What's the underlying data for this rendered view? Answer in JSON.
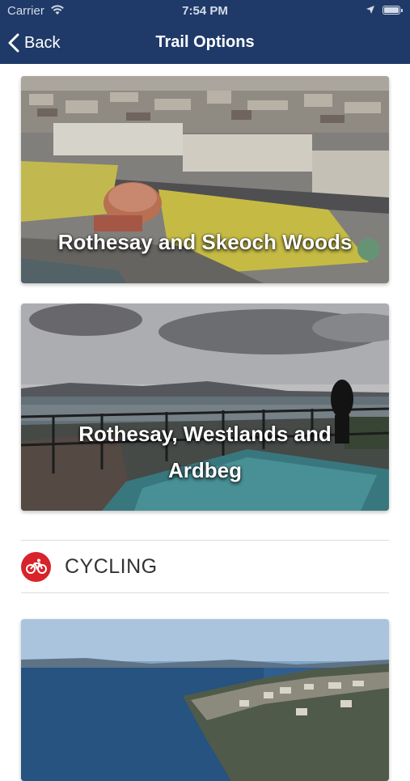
{
  "status_bar": {
    "carrier": "Carrier",
    "time": "7:54 PM"
  },
  "nav": {
    "back_label": "Back",
    "title": "Trail Options"
  },
  "trails": [
    {
      "label": "Rothesay and Skeoch Woods"
    },
    {
      "label_line1": "Rothesay, Westlands and",
      "label_line2": "Ardbeg"
    }
  ],
  "section": {
    "label": "CYCLING",
    "icon": "bicycle-icon",
    "accent": "#d8232a"
  },
  "colors": {
    "nav_bar": "#1f3a68"
  }
}
